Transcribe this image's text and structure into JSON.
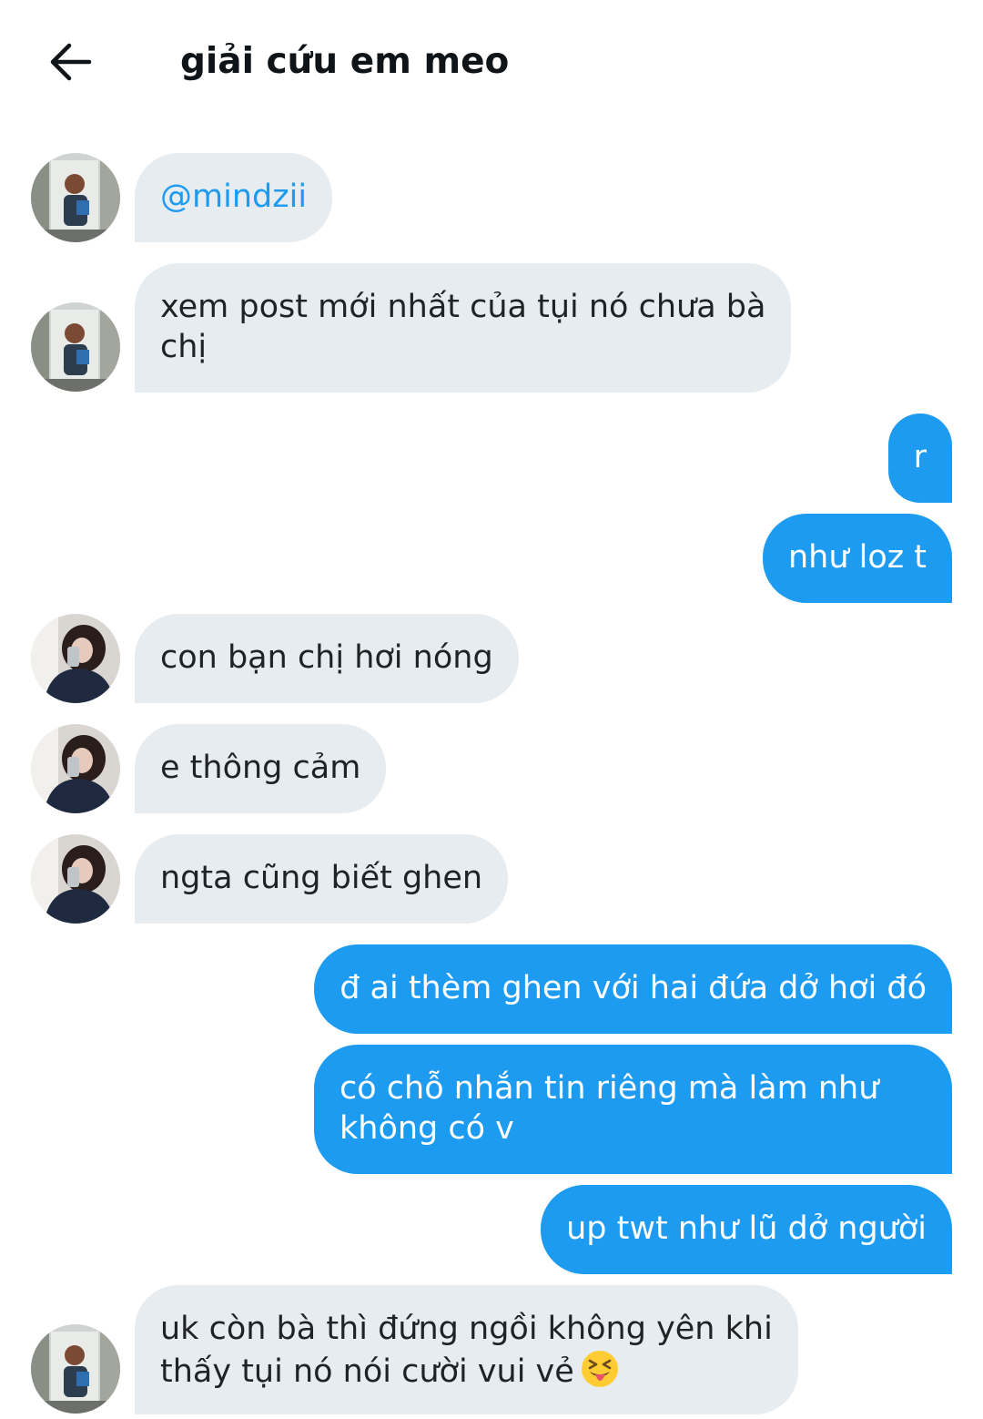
{
  "header": {
    "back_icon": "arrow-left-icon",
    "title": "giải cứu em meo"
  },
  "messages": [
    {
      "side": "in",
      "avatar": "avatar-photo-mirror",
      "text": "@mindzii"
    },
    {
      "side": "in",
      "avatar": "avatar-photo-mirror",
      "lines": [
        "xem post mới nhất của tụi nó chưa bà",
        "chị"
      ]
    },
    {
      "side": "out",
      "text": "r"
    },
    {
      "side": "out",
      "text": "như loz t"
    },
    {
      "side": "in",
      "avatar": "avatar-photo-hair",
      "text": "con bạn chị hơi nóng"
    },
    {
      "side": "in",
      "avatar": "avatar-photo-hair",
      "text": "e thông cảm"
    },
    {
      "side": "in",
      "avatar": "avatar-photo-hair",
      "text": "ngta cũng biết ghen"
    },
    {
      "side": "out",
      "text": "đ ai thèm ghen với hai đứa dở hơi đó"
    },
    {
      "side": "out",
      "lines": [
        "có chỗ nhắn tin riêng mà làm như",
        "không có v"
      ]
    },
    {
      "side": "out",
      "text": "up twt như lũ dở người"
    },
    {
      "side": "in",
      "avatar": "avatar-photo-mirror",
      "lines": [
        "uk còn bà thì đứng ngồi không yên khi",
        "thấy tụi nó nói cười vui vẻ"
      ],
      "emoji": "squinting-face-with-tongue-icon"
    }
  ],
  "colors": {
    "incoming_bubble": "#e6ecf0",
    "outgoing_bubble": "#1d9bf0",
    "mention": "#1d9bf0"
  }
}
